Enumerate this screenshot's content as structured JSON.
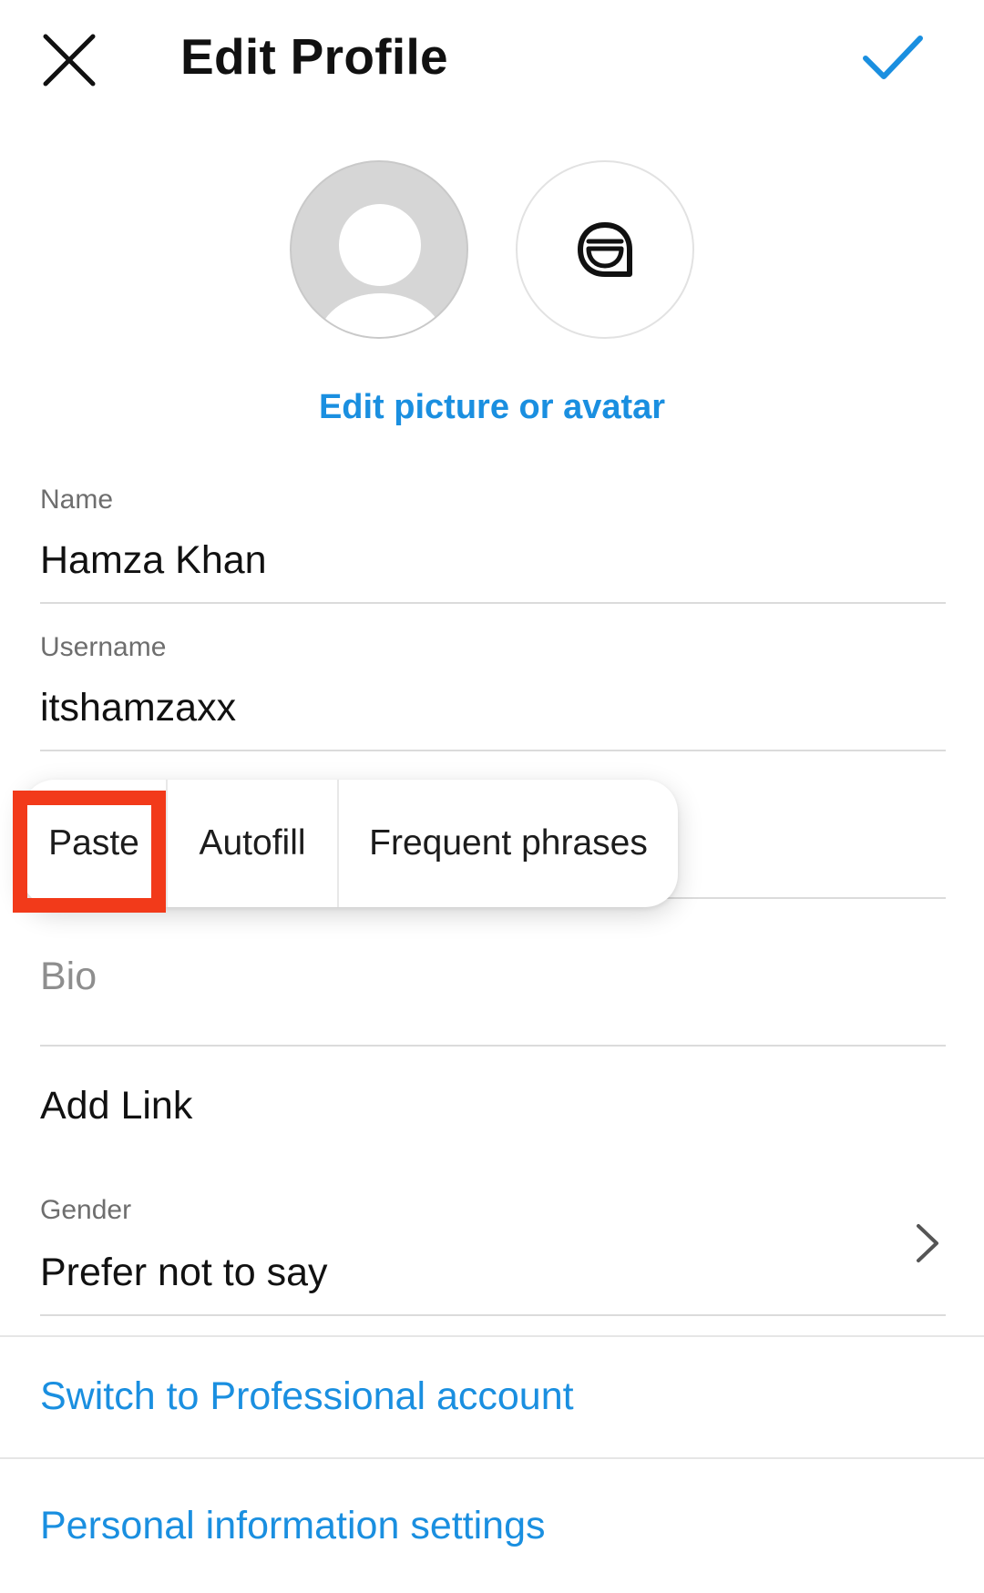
{
  "header": {
    "title": "Edit Profile",
    "close_icon": "close-icon",
    "done_icon": "checkmark-icon",
    "accent_color": "#1a8fe0"
  },
  "avatar": {
    "photo_icon": "default-avatar-icon",
    "sticker_icon": "avatar-face-icon",
    "edit_link": "Edit picture or avatar"
  },
  "fields": {
    "name": {
      "label": "Name",
      "value": "Hamza Khan"
    },
    "username": {
      "label": "Username",
      "value": "itshamzaxx"
    },
    "bio": {
      "placeholder": "Bio"
    },
    "add_link": "Add Link",
    "gender": {
      "label": "Gender",
      "value": "Prefer not to say",
      "icon": "chevron-right-icon"
    }
  },
  "links": {
    "professional": "Switch to Professional account",
    "personal_info": "Personal information settings"
  },
  "context_menu": {
    "items": [
      "Paste",
      "Autofill",
      "Frequent phrases"
    ],
    "highlighted": "Paste",
    "highlight_color": "#f23a1a"
  }
}
